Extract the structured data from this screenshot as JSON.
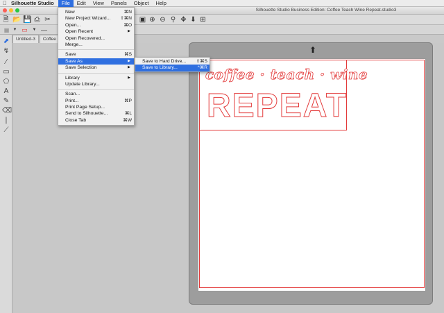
{
  "menubar": {
    "app_name": "Silhouette Studio",
    "items": [
      "File",
      "Edit",
      "View",
      "Panels",
      "Object",
      "Help"
    ]
  },
  "window": {
    "title": "Silhouette Studio Business Edition: Coffee Teach Wine Repeat.studio3"
  },
  "tabs": [
    "Untitled-3",
    "Coffee"
  ],
  "file_menu": {
    "group1": [
      {
        "label": "New",
        "shortcut": "⌘N"
      },
      {
        "label": "New Project Wizard...",
        "shortcut": "⇧⌘N"
      },
      {
        "label": "Open...",
        "shortcut": "⌘O"
      },
      {
        "label": "Open Recent",
        "shortcut": ""
      },
      {
        "label": "Open Recovered...",
        "shortcut": ""
      },
      {
        "label": "Merge...",
        "shortcut": ""
      }
    ],
    "group2": [
      {
        "label": "Save",
        "shortcut": "⌘S"
      },
      {
        "label": "Save As",
        "shortcut": ""
      },
      {
        "label": "Save Selection",
        "shortcut": ""
      }
    ],
    "group3": [
      {
        "label": "Library",
        "shortcut": ""
      },
      {
        "label": "Update Library...",
        "shortcut": ""
      }
    ],
    "group4": [
      {
        "label": "Scan...",
        "shortcut": ""
      },
      {
        "label": "Print...",
        "shortcut": "⌘P"
      },
      {
        "label": "Print Page Setup...",
        "shortcut": ""
      },
      {
        "label": "Send to Silhouette...",
        "shortcut": "⌘L"
      },
      {
        "label": "Close Tab",
        "shortcut": "⌘W"
      }
    ]
  },
  "save_as_submenu": [
    {
      "label": "Save to Hard Drive...",
      "shortcut": "⇧⌘S"
    },
    {
      "label": "Save to Library...",
      "shortcut": "^⌘R"
    }
  ],
  "design": {
    "line1": "coffee · teach · wine",
    "line2": "REPEAT"
  },
  "colors": {
    "menu_highlight": "#2f6fe0",
    "cut_line": "#e33a3a"
  }
}
